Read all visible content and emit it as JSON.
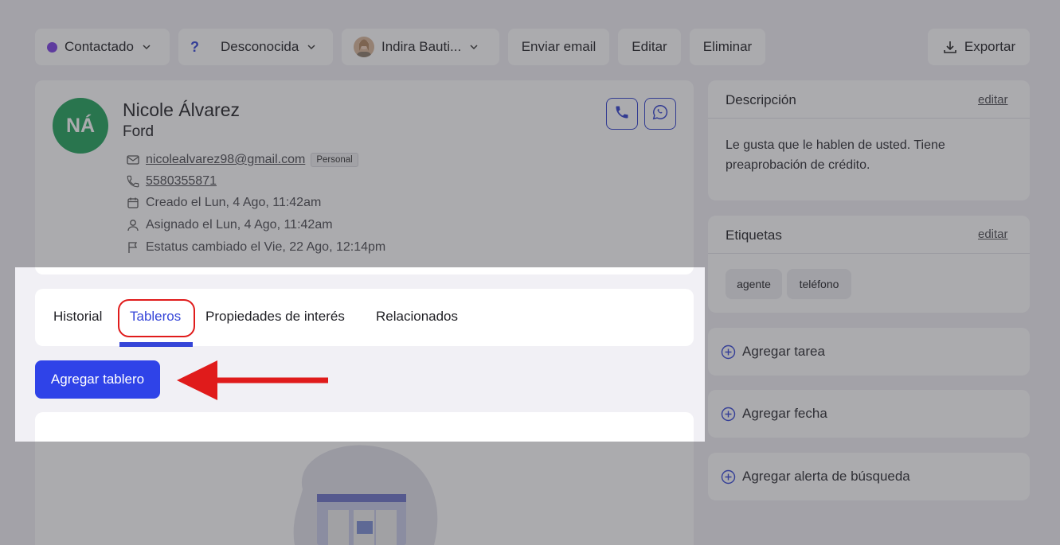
{
  "toolbar": {
    "status_label": "Contactado",
    "status_color": "#7b3fe4",
    "source_label": "Desconocida",
    "agent_label": "Indira Bauti...",
    "send_email_label": "Enviar email",
    "edit_label": "Editar",
    "delete_label": "Eliminar",
    "export_label": "Exportar"
  },
  "contact": {
    "initials": "NÁ",
    "avatar_color": "#1fa25a",
    "name": "Nicole Álvarez",
    "company": "Ford",
    "email": "nicolealvarez98@gmail.com",
    "email_type": "Personal",
    "phone": "5580355871",
    "created": "Creado el Lun, 4 Ago, 11:42am",
    "assigned": "Asignado el Lun, 4 Ago, 11:42am",
    "status_changed": "Estatus cambiado el Vie, 22 Ago, 12:14pm"
  },
  "tabs": [
    {
      "label": "Historial"
    },
    {
      "label": "Tableros"
    },
    {
      "label": "Propiedades de interés"
    },
    {
      "label": "Relacionados"
    }
  ],
  "active_tab": "Tableros",
  "boards": {
    "add_board_label": "Agregar tablero"
  },
  "sidebar": {
    "description": {
      "title": "Descripción",
      "edit_label": "editar",
      "text": "Le gusta que le hablen de usted. Tiene preaprobación de crédito."
    },
    "tags": {
      "title": "Etiquetas",
      "edit_label": "editar",
      "items": [
        "agente",
        "teléfono"
      ]
    },
    "actions": [
      {
        "label": "Agregar tarea"
      },
      {
        "label": "Agregar fecha"
      },
      {
        "label": "Agregar alerta de búsqueda"
      }
    ]
  },
  "colors": {
    "accent": "#2f43e8",
    "annotation": "#e01b1b"
  }
}
